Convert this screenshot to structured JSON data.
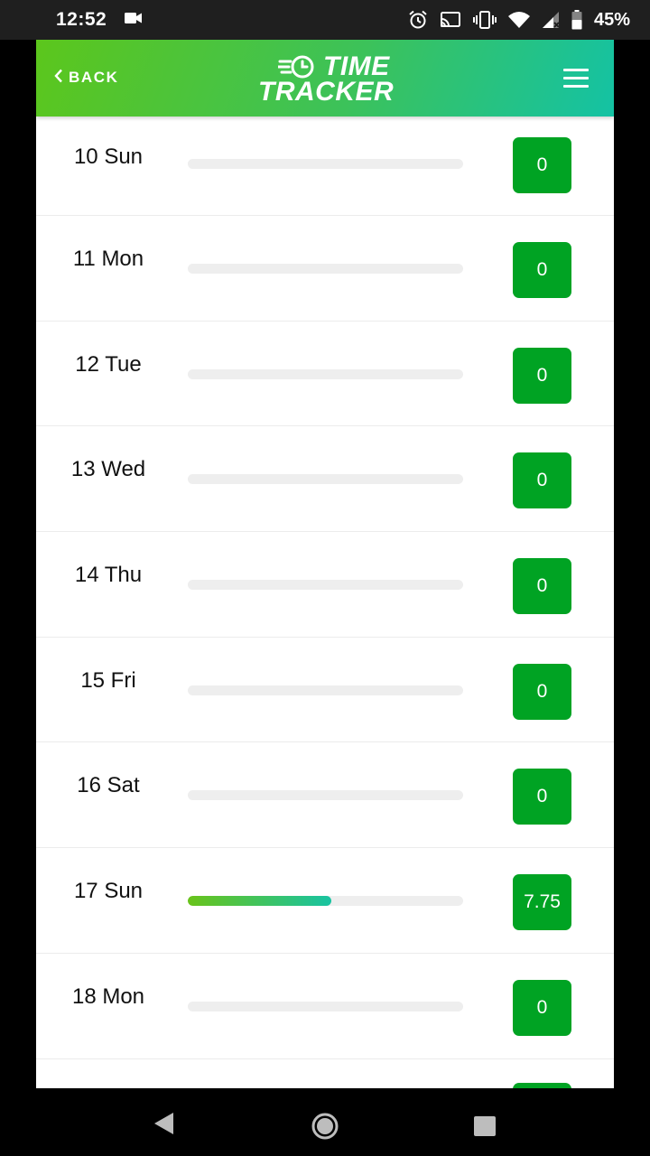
{
  "status_bar": {
    "time": "12:52",
    "battery": "45%"
  },
  "header": {
    "back_label": "BACK",
    "logo_line1": "TIME",
    "logo_line2": "TRACKER"
  },
  "colors": {
    "header_gradient_start": "#5cc61c",
    "header_gradient_end": "#14c2a4",
    "hours_box": "#00a323",
    "progress_start": "#69c31a",
    "progress_end": "#18c3a2"
  },
  "days": [
    {
      "label": "10 Sun",
      "hours": "0",
      "progress": 0
    },
    {
      "label": "11 Mon",
      "hours": "0",
      "progress": 0
    },
    {
      "label": "12 Tue",
      "hours": "0",
      "progress": 0
    },
    {
      "label": "13 Wed",
      "hours": "0",
      "progress": 0
    },
    {
      "label": "14 Thu",
      "hours": "0",
      "progress": 0
    },
    {
      "label": "15 Fri",
      "hours": "0",
      "progress": 0
    },
    {
      "label": "16 Sat",
      "hours": "0",
      "progress": 0
    },
    {
      "label": "17 Sun",
      "hours": "7.75",
      "progress": 0.52
    },
    {
      "label": "18 Mon",
      "hours": "0",
      "progress": 0
    }
  ]
}
